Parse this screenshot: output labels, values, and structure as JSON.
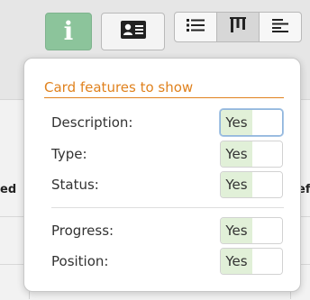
{
  "toolbar": {
    "info_button_icon": "info-icon",
    "card_button_icon": "id-card-icon",
    "view_modes": [
      {
        "icon": "list-icon",
        "active": false
      },
      {
        "icon": "columns-icon",
        "active": true
      },
      {
        "icon": "align-left-icon",
        "active": false
      }
    ]
  },
  "background": {
    "left_cut_text": "ed",
    "right_cut_text": "ef"
  },
  "popover": {
    "title": "Card features to show",
    "features": [
      {
        "label": "Description:",
        "value": "Yes",
        "focused": true
      },
      {
        "label": "Type:",
        "value": "Yes",
        "focused": false
      },
      {
        "label": "Status:",
        "value": "Yes",
        "focused": false
      },
      {
        "label": "Progress:",
        "value": "Yes",
        "focused": false
      },
      {
        "label": "Position:",
        "value": "Yes",
        "focused": false
      }
    ]
  },
  "colors": {
    "accent": "#e0821e",
    "info_button": "#8cc49b",
    "toggle_on": "#e1f0d8"
  }
}
